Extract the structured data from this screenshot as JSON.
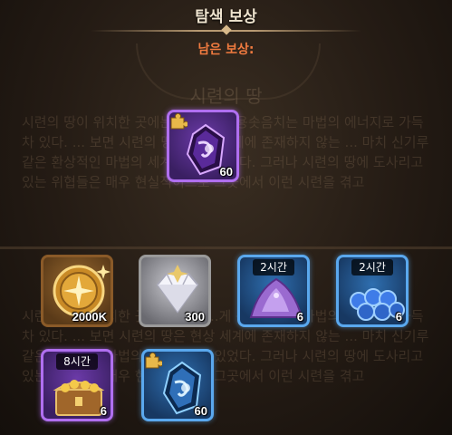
{
  "header": {
    "title": "탐색 보상",
    "subtitle": "남은 보상:"
  },
  "background": {
    "chapter_title": "시련의 땅",
    "story_text": "시련의 땅이 위치한 곳에는 어떤 ...게 용솟음치는 마법의 에너지로 가득 차 있다. ... 보면 시련의 땅은 현상 세계에 존재하지 않는 ... 마치 신기루 같은 환상적인 마법의 세계와 닮아있었다. 그러나 시련의 땅에 도사리고 있는 위협들은 매우 현실적이므로 그곳에서 이런 시련을 겪고"
  },
  "featured_reward": {
    "name": "purple-crystal-item",
    "rarity": "purple",
    "count": "60"
  },
  "rewards": [
    {
      "name": "gold-coin-item",
      "rarity": "gold",
      "count": "2000K",
      "timer": ""
    },
    {
      "name": "diamond-item",
      "rarity": "white",
      "count": "300",
      "timer": ""
    },
    {
      "name": "purple-stone-item",
      "rarity": "blue",
      "count": "6",
      "timer": "2시간"
    },
    {
      "name": "blue-orbs-item",
      "rarity": "blue",
      "count": "6",
      "timer": "2시간"
    },
    {
      "name": "treasure-chest-item",
      "rarity": "purple",
      "count": "6",
      "timer": "8시간"
    },
    {
      "name": "blue-crystal-item",
      "rarity": "blue",
      "count": "60",
      "timer": ""
    }
  ],
  "colors": {
    "subtitle": "#ef7a3f",
    "purple_frame": "#b06ff0",
    "blue_frame": "#5aa8ee",
    "gold_frame": "#8a5a28"
  }
}
